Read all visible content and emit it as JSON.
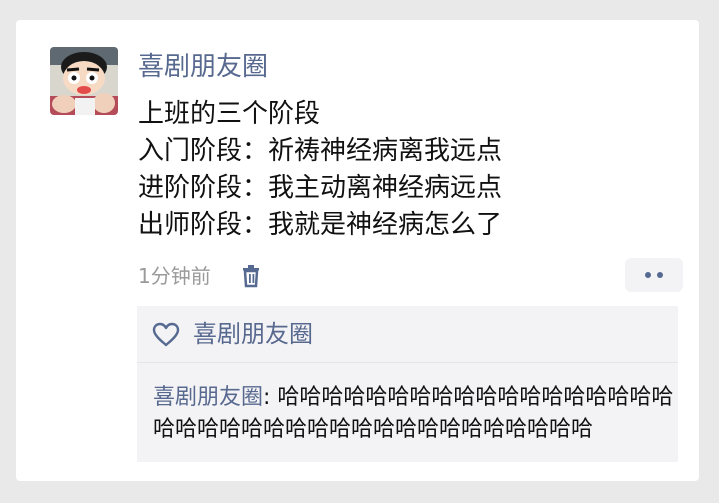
{
  "post": {
    "author": "喜剧朋友圈",
    "lines": [
      "上班的三个阶段",
      "入门阶段：祈祷神经病离我远点",
      "进阶阶段：我主动离神经病远点",
      "出师阶段：我就是神经病怎么了"
    ],
    "timestamp": "1分钟前"
  },
  "likes": {
    "names": "喜剧朋友圈"
  },
  "comment": {
    "author": "喜剧朋友圈",
    "separator": ": ",
    "text": "哈哈哈哈哈哈哈哈哈哈哈哈哈哈哈哈哈哈哈哈哈哈哈哈哈哈哈哈哈哈哈哈哈哈哈哈哈哈"
  },
  "colors": {
    "link": "#58698f",
    "text": "#111111",
    "muted": "#9a9a9a",
    "comment_bg": "#f3f3f5"
  },
  "icons": [
    "avatar",
    "trash-icon",
    "more-icon",
    "heart-icon"
  ]
}
